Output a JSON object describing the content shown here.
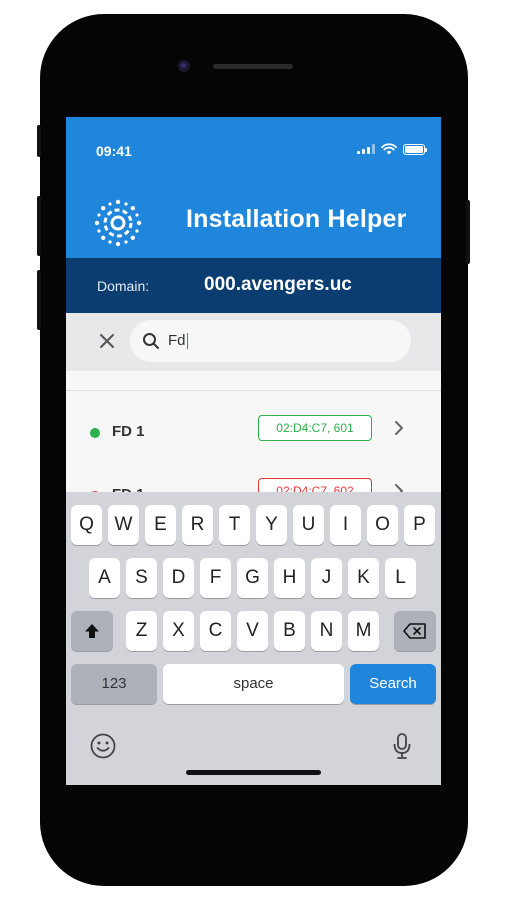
{
  "status_bar": {
    "time": "09:41"
  },
  "header": {
    "title": "Installation Helper",
    "logo_icon": "gear-dots-icon"
  },
  "domain": {
    "label": "Domain:",
    "value": "000.avengers.uc"
  },
  "search": {
    "value": "Fd",
    "clear_icon": "close-icon",
    "search_icon": "search-icon"
  },
  "devices": [
    {
      "name": "FD 1",
      "mac": "02:D4:C7, 601",
      "status_color": "#2bb24c"
    },
    {
      "name": "FD 1",
      "mac": "02:D4:C7, 602",
      "status_color": "#e53935"
    }
  ],
  "keyboard": {
    "row1": [
      "Q",
      "W",
      "E",
      "R",
      "T",
      "Y",
      "U",
      "I",
      "O",
      "P"
    ],
    "row2": [
      "A",
      "S",
      "D",
      "F",
      "G",
      "H",
      "J",
      "K",
      "L"
    ],
    "row3": [
      "Z",
      "X",
      "C",
      "V",
      "B",
      "N",
      "M"
    ],
    "numbers_label": "123",
    "space_label": "space",
    "search_label": "Search"
  },
  "colors": {
    "primary": "#1f86dc",
    "domain_bar": "#0b3d70"
  }
}
